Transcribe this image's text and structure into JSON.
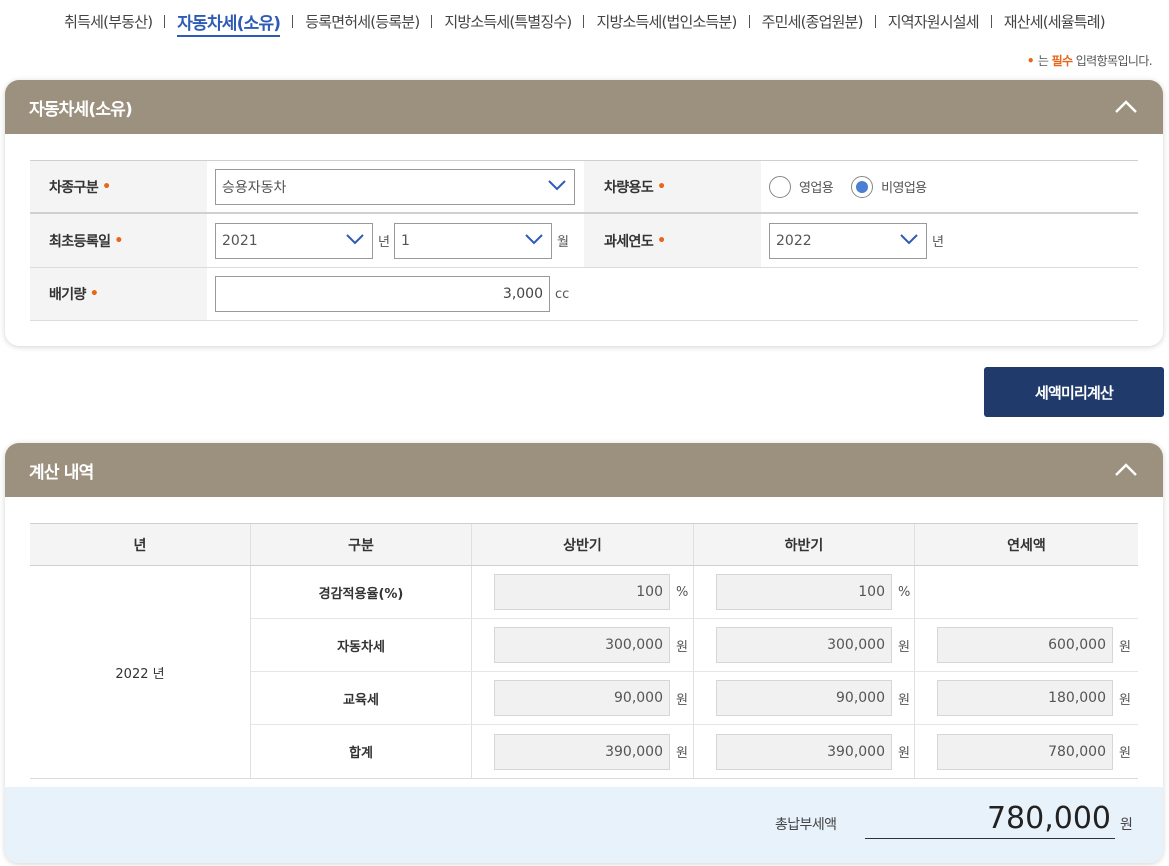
{
  "tabs": [
    {
      "label": "취득세(부동산)",
      "active": false
    },
    {
      "label": "자동차세(소유)",
      "active": true
    },
    {
      "label": "등록면허세(등록분)",
      "active": false
    },
    {
      "label": "지방소득세(특별징수)",
      "active": false
    },
    {
      "label": "지방소득세(법인소득분)",
      "active": false
    },
    {
      "label": "주민세(종업원분)",
      "active": false
    },
    {
      "label": "지역자원시설세",
      "active": false
    },
    {
      "label": "재산세(세율특례)",
      "active": false
    }
  ],
  "required_note": {
    "dot": "•",
    "prefix": "는",
    "emphasis": "필수",
    "suffix": "입력항목입니다."
  },
  "form_panel": {
    "title": "자동차세(소유)",
    "required_mark": "•",
    "vehicle_type": {
      "label": "차종구분",
      "value": "승용자동차"
    },
    "vehicle_use": {
      "label": "차량용도",
      "options": [
        "영업용",
        "비영업용"
      ],
      "selected": "비영업용"
    },
    "first_registration": {
      "label": "최초등록일",
      "year": "2021",
      "year_unit": "년",
      "month": "1",
      "month_unit": "월"
    },
    "tax_year": {
      "label": "과세연도",
      "value": "2022",
      "unit": "년"
    },
    "displacement": {
      "label": "배기량",
      "value": "3,000",
      "unit": "cc"
    }
  },
  "calc_button": {
    "label": "세액미리계산"
  },
  "result_panel": {
    "title": "계산 내역",
    "headers": [
      "년",
      "구분",
      "상반기",
      "하반기",
      "연세액"
    ],
    "year_label": "2022 년",
    "rows": [
      {
        "name": "경감적용율(%)",
        "first": "100",
        "second": "100",
        "annual": "",
        "unit": "%"
      },
      {
        "name": "자동차세",
        "first": "300,000",
        "second": "300,000",
        "annual": "600,000",
        "unit": "원"
      },
      {
        "name": "교육세",
        "first": "90,000",
        "second": "90,000",
        "annual": "180,000",
        "unit": "원"
      },
      {
        "name": "합계",
        "first": "390,000",
        "second": "390,000",
        "annual": "780,000",
        "unit": "원"
      }
    ],
    "total": {
      "label": "총납부세액",
      "amount": "780,000",
      "unit": "원"
    }
  },
  "colors": {
    "accent": "#2f5bb7",
    "panel_header": "#9c917e",
    "button": "#203a6b",
    "required": "#e8651a",
    "total_bar": "#e8f2fb"
  }
}
